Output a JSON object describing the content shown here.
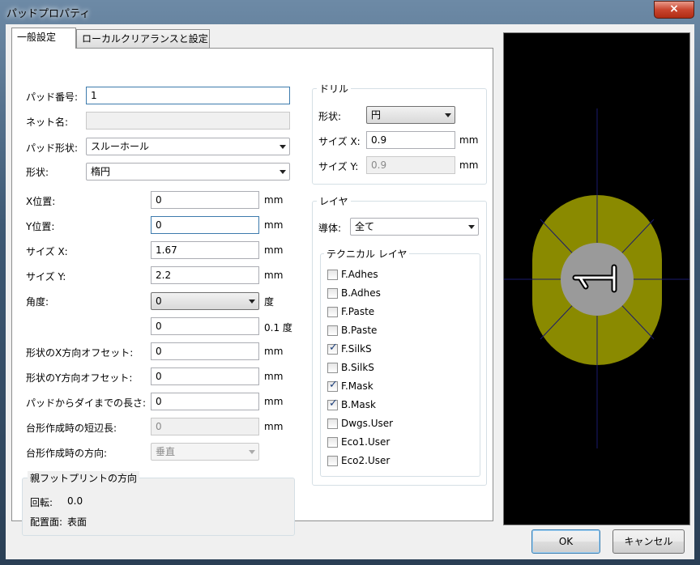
{
  "window": {
    "title": "パッドプロパティ",
    "close_label": "×"
  },
  "tabs": [
    {
      "label": "一般設定"
    },
    {
      "label": "ローカルクリアランスと設定"
    }
  ],
  "pad": {
    "pad_number": {
      "label": "パッド番号:",
      "value": "1"
    },
    "net_name": {
      "label": "ネット名:",
      "value": ""
    },
    "pad_type": {
      "label": "パッド形状:",
      "value": "スルーホール"
    },
    "shape": {
      "label": "形状:",
      "value": "楕円"
    },
    "x_pos": {
      "label": "X位置:",
      "value": "0",
      "unit": "mm"
    },
    "y_pos": {
      "label": "Y位置:",
      "value": "0",
      "unit": "mm"
    },
    "size_x": {
      "label": "サイズ X:",
      "value": "1.67",
      "unit": "mm"
    },
    "size_y": {
      "label": "サイズ Y:",
      "value": "2.2",
      "unit": "mm"
    },
    "angle": {
      "label": "角度:",
      "value": "0",
      "unit": "度",
      "value2": "0",
      "unit2": "0.1 度"
    },
    "offset_x": {
      "label": "形状のX方向オフセット:",
      "value": "0",
      "unit": "mm"
    },
    "offset_y": {
      "label": "形状のY方向オフセット:",
      "value": "0",
      "unit": "mm"
    },
    "die_length": {
      "label": "パッドからダイまでの長さ:",
      "value": "0",
      "unit": "mm"
    },
    "trap_delta": {
      "label": "台形作成時の短辺長:",
      "value": "0",
      "unit": "mm"
    },
    "trap_dir": {
      "label": "台形作成時の方向:",
      "value": "垂直"
    }
  },
  "footprint": {
    "title": "親フットプリントの方向",
    "rotation_label": "回転:",
    "rotation_value": "0.0",
    "side_label": "配置面:",
    "side_value": "表面"
  },
  "drill": {
    "title": "ドリル",
    "shape_label": "形状:",
    "shape_value": "円",
    "size_x_label": "サイズ X:",
    "size_x_value": "0.9",
    "size_x_unit": "mm",
    "size_y_label": "サイズ Y:",
    "size_y_value": "0.9",
    "size_y_unit": "mm"
  },
  "layers": {
    "title": "レイヤ",
    "copper_label": "導体:",
    "copper_value": "全て",
    "technical_title": "テクニカル レイヤ",
    "items": [
      {
        "label": "F.Adhes",
        "checked": false
      },
      {
        "label": "B.Adhes",
        "checked": false
      },
      {
        "label": "F.Paste",
        "checked": false
      },
      {
        "label": "B.Paste",
        "checked": false
      },
      {
        "label": "F.SilkS",
        "checked": true
      },
      {
        "label": "B.SilkS",
        "checked": false
      },
      {
        "label": "F.Mask",
        "checked": true
      },
      {
        "label": "B.Mask",
        "checked": true
      },
      {
        "label": "Dwgs.User",
        "checked": false
      },
      {
        "label": "Eco1.User",
        "checked": false
      },
      {
        "label": "Eco2.User",
        "checked": false
      }
    ]
  },
  "colors": {
    "pad": "#8a8a00",
    "hole": "#9a9a9a",
    "crosshair": "#1a1a6e"
  },
  "buttons": {
    "ok": "OK",
    "cancel": "キャンセル"
  }
}
